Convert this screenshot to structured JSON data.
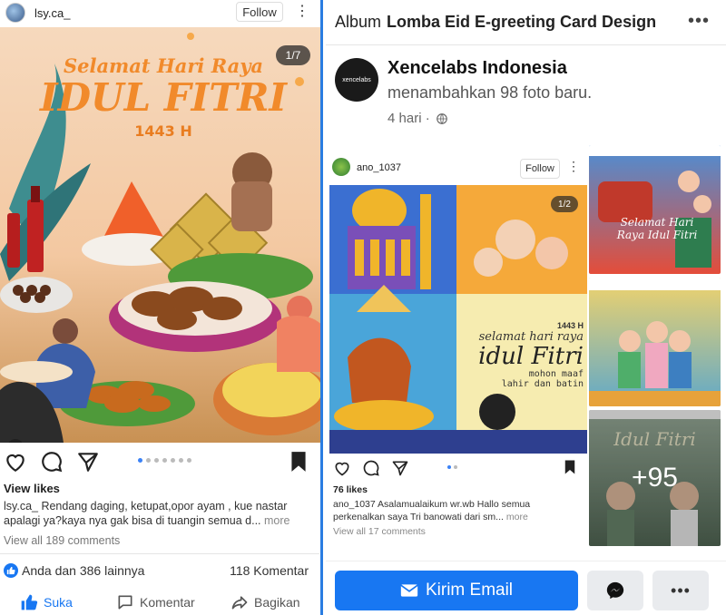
{
  "left_post": {
    "username": "lsy.ca_",
    "follow_label": "Follow",
    "more_label": "⋮",
    "image": {
      "counter": "1/7",
      "title_line1": "Selamat Hari Raya",
      "title_line2": "IDUL FITRI",
      "title_line3": "1443 H"
    },
    "view_likes": "View likes",
    "caption_user": "lsy.ca_",
    "caption_text": " Rendang daging, ketupat,opor ayam , kue nastar apalagi ya?kaya nya gak bisa di tuangin semua d...",
    "caption_more": "more",
    "view_comments": "View all 189 comments",
    "reactions_text": "Anda dan 386 lainnya",
    "comments_count": "118 Komentar",
    "actions": {
      "like": "Suka",
      "comment": "Komentar",
      "share": "Bagikan"
    },
    "colors": {
      "facebook_blue": "#1877f2"
    }
  },
  "right_panel": {
    "album_prefix": "Album",
    "album_name": "Lomba Eid E-greeting Card Design",
    "more_label": "•••",
    "page_logo_text": "xencelabs",
    "page_name": "Xencelabs Indonesia",
    "page_subtitle": "menambahkan 98 foto baru.",
    "page_time": "4 hari ·",
    "main_post": {
      "username": "ano_1037",
      "follow_label": "Follow",
      "counter": "1/2",
      "image_text": {
        "year": "1443 H",
        "line1": "selamat hari raya",
        "line2": "idul Fitri",
        "line3": "mohon maaf",
        "line4": "lahir dan batin"
      },
      "likes": "76 likes",
      "caption_user": "ano_1037",
      "caption_text": " Asalamualaikum wr.wb Hallo semua perkenalkan saya Tri banowati dari sm...",
      "caption_more": "more",
      "view_comments": "View all 17 comments"
    },
    "thumbs": [
      {
        "text": "Selamat Hari Raya Idul Fitri"
      },
      {
        "text": ""
      },
      {
        "text": "Idul Fitri",
        "overlay": "+95"
      }
    ],
    "bottom": {
      "email_label": "Kirim Email"
    },
    "colors": {
      "facebook_blue": "#1877f2"
    }
  }
}
